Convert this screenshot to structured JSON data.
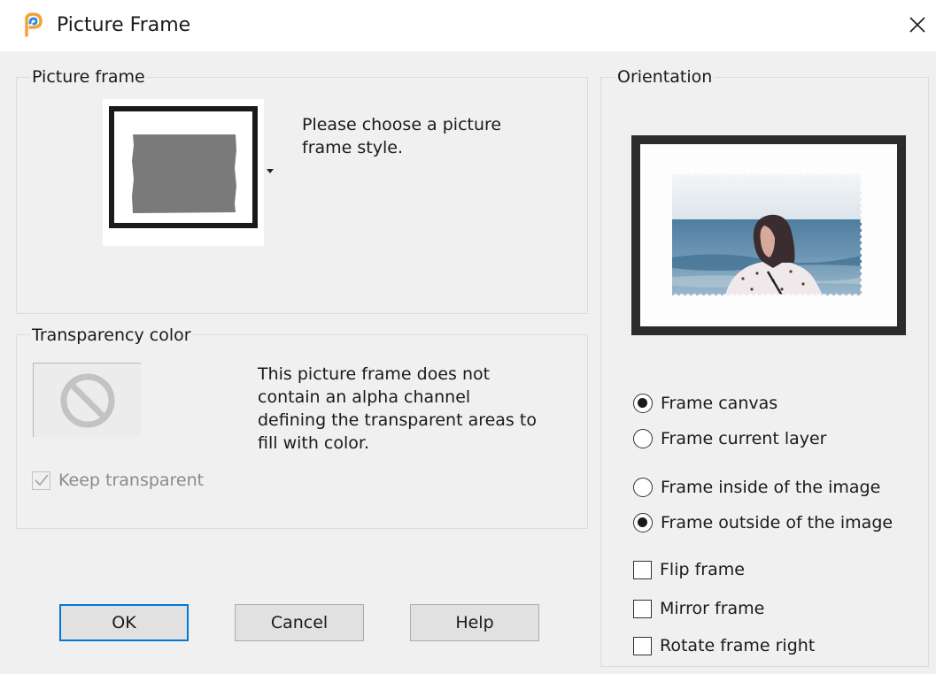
{
  "window": {
    "title": "Picture Frame",
    "icon": "paintshop-pro-app-icon"
  },
  "picture_frame_group": {
    "label": "Picture frame",
    "instruction": [
      "Please choose a picture",
      "frame style."
    ]
  },
  "transparency_group": {
    "label": "Transparency color",
    "description": [
      "This picture frame does not",
      "contain an alpha channel",
      "defining the transparent areas to",
      "fill with color."
    ],
    "keep_transparent_label": "Keep transparent",
    "keep_transparent_checked": true,
    "keep_transparent_enabled": false
  },
  "orientation_group": {
    "label": "Orientation",
    "apply_to": [
      {
        "label": "Frame canvas",
        "checked": true
      },
      {
        "label": "Frame current layer",
        "checked": false
      }
    ],
    "placement": [
      {
        "label": "Frame inside of the image",
        "checked": false
      },
      {
        "label": "Frame outside of the image",
        "checked": true
      }
    ],
    "options": [
      {
        "label": "Flip frame",
        "checked": false
      },
      {
        "label": "Mirror frame",
        "checked": false
      },
      {
        "label": "Rotate frame right",
        "checked": false
      }
    ]
  },
  "buttons": {
    "ok": "OK",
    "cancel": "Cancel",
    "help": "Help"
  },
  "colors": {
    "dialog_bg": "#f0f0f0",
    "default_button_border": "#0078d7",
    "frame_dark": "#2b2b2b",
    "frame_swatch_gray": "#7a7a7a"
  }
}
